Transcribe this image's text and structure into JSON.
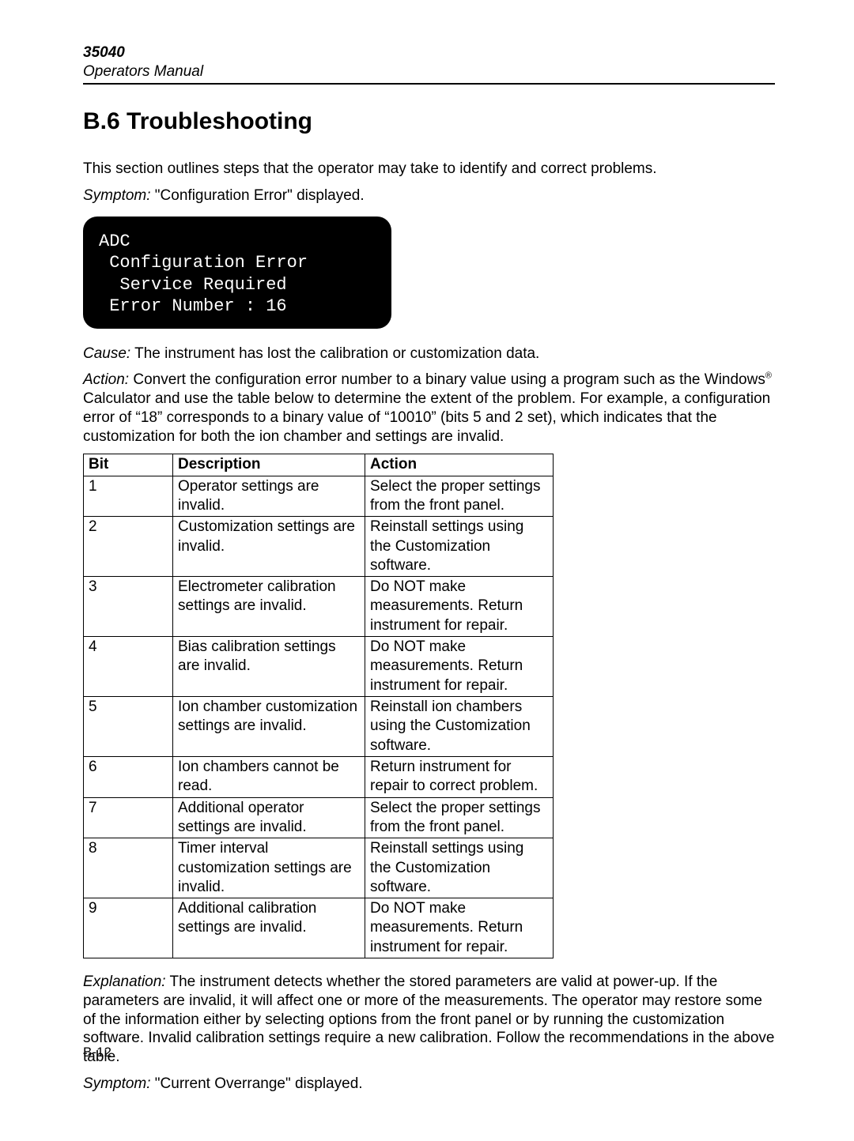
{
  "header": {
    "doc_number": "35040",
    "doc_title": "Operators Manual"
  },
  "section_heading": "B.6 Troubleshooting",
  "intro_para": "This section outlines steps that the operator may take to identify and correct problems.",
  "symptom1_label": "Symptom:",
  "symptom1_text": "  \"Configuration Error\" displayed.",
  "display": {
    "l1": "ADC",
    "l2": " Configuration Error",
    "l3": "  Service Required",
    "l4": " Error Number : 16"
  },
  "cause_label": "Cause:",
  "cause_text": "  The instrument has lost the calibration or customization data.",
  "action_label": "Action:",
  "action_text_a": "  Convert the configuration error number to a binary value using a program such as the Windows",
  "action_text_b": " Calculator and use the table below to determine the extent of the problem.  For example, a configuration error of “18” corresponds to a binary value of “10010” (bits 5 and 2 set), which indicates that the customization for both the ion chamber and settings are invalid.",
  "table": {
    "h_bit": "Bit",
    "h_desc": "Description",
    "h_act": "Action",
    "rows": [
      {
        "bit": "1",
        "desc": "Operator settings are invalid.",
        "act": "Select the proper settings from the front panel."
      },
      {
        "bit": "2",
        "desc": "Customization settings are invalid.",
        "act": "Reinstall settings using the Customization software."
      },
      {
        "bit": "3",
        "desc": "Electrometer calibration settings are invalid.",
        "act": "Do NOT make measurements.  Return instrument for repair."
      },
      {
        "bit": "4",
        "desc": "Bias calibration settings are invalid.",
        "act": "Do NOT make measurements.  Return instrument for repair."
      },
      {
        "bit": "5",
        "desc": "Ion chamber customization settings are invalid.",
        "act": "Reinstall ion chambers using the Customization software."
      },
      {
        "bit": "6",
        "desc": "Ion chambers cannot be read.",
        "act": "Return instrument for repair to correct problem."
      },
      {
        "bit": "7",
        "desc": "Additional operator settings are invalid.",
        "act": "Select the proper settings from the front panel."
      },
      {
        "bit": "8",
        "desc": "Timer interval customization settings are invalid.",
        "act": "Reinstall settings using the Customization software."
      },
      {
        "bit": "9",
        "desc": "Additional calibration settings are invalid.",
        "act": "Do NOT make measurements.  Return instrument for repair."
      }
    ]
  },
  "explanation_label": "Explanation:",
  "explanation_text": "  The instrument detects whether the stored parameters are valid at power-up.  If the parameters are invalid, it will affect one or more of the measurements.  The operator may restore some of the information either by selecting options from the front panel or by running the customization software.  Invalid calibration settings require a new calibration.  Follow the recommendations in the above table.",
  "symptom2_label": "Symptom:",
  "symptom2_text": "  \"Current Overrange\" displayed.",
  "page_number": "B-12"
}
